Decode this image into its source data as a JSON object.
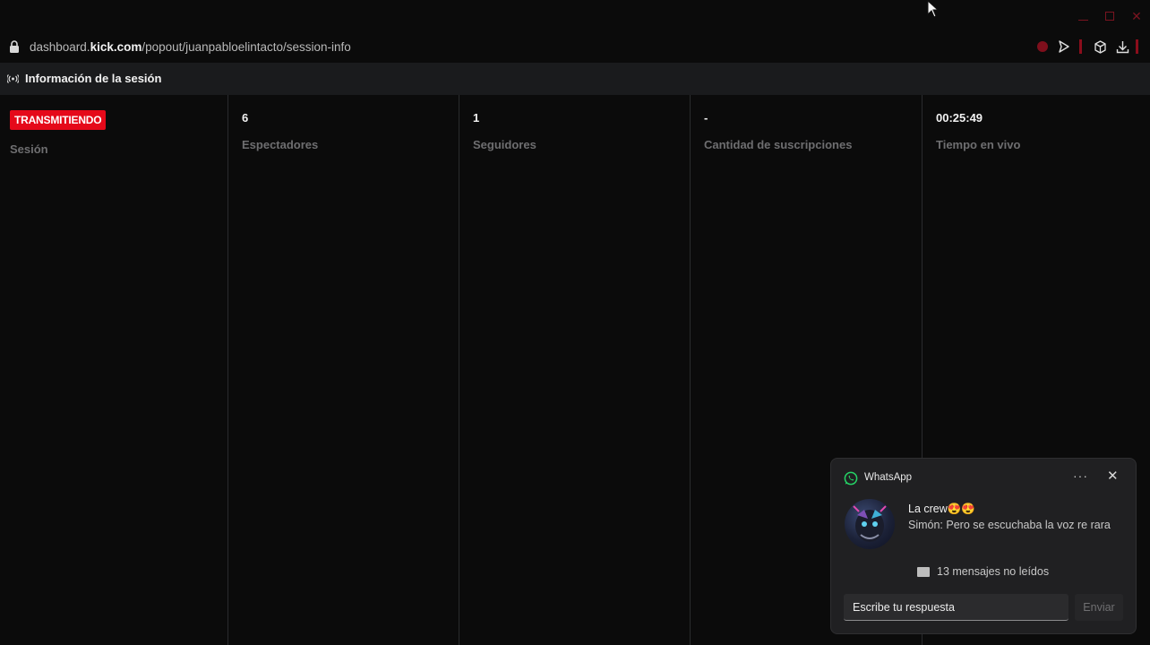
{
  "window": {
    "minimize_icon": "minimize-icon",
    "maximize_icon": "maximize-icon",
    "close_icon": "close-icon",
    "accent_color": "#7a1420"
  },
  "address_bar": {
    "url_prefix": "dashboard.",
    "url_domain": "kick.com",
    "url_path": "/popout/juanpabloelintacto/session-info"
  },
  "header": {
    "title": "Información de la sesión"
  },
  "session": {
    "status_badge": "TRANSMITIENDO",
    "status_color": "#e5091a",
    "label": "Sesión"
  },
  "stats": [
    {
      "value": "6",
      "label": "Espectadores"
    },
    {
      "value": "1",
      "label": "Seguidores"
    },
    {
      "value": "-",
      "label": "Cantidad de suscripciones"
    },
    {
      "value": "00:25:49",
      "label": "Tiempo en vivo"
    }
  ],
  "notification": {
    "app_name": "WhatsApp",
    "more_label": "···",
    "close_label": "✕",
    "chat_title": "La crew😍😍",
    "message": "Simón: Pero se escuchaba la voz re rara",
    "unread": "13 mensajes no leídos",
    "reply_placeholder": "Escribe tu respuesta",
    "send_label": "Enviar",
    "brand_color": "#25d366"
  }
}
